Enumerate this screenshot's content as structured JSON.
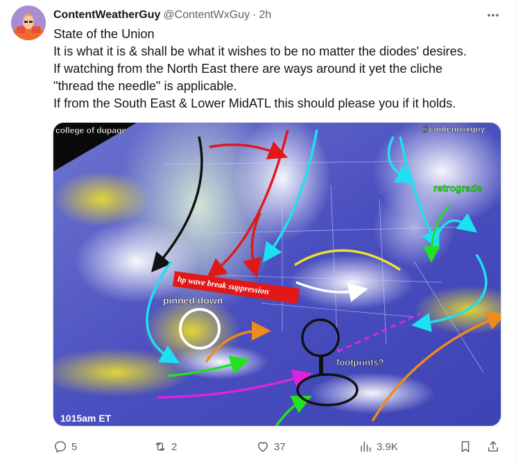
{
  "tweet": {
    "author_name": "ContentWeatherGuy",
    "handle": "@ContentWxGuy",
    "separator": "·",
    "time": "2h",
    "more_icon": "more-dots-icon",
    "lines": [
      "State of the Union",
      "It is what it is & shall be what it wishes to be no matter the diodes' desires.",
      "If watching from the North East there are ways around it yet the cliche",
      "\"thread the needle\" is applicable.",
      "If from the South East & Lower MidATL this should please you if it holds."
    ]
  },
  "image": {
    "watermark_left": "college of dupage",
    "watermark_right": "@contentwxguy",
    "label_retrograde": "retrograde",
    "label_hp": "hp wave break suppression",
    "label_pinned": "pinned down",
    "label_footprints": "footprints?",
    "label_time": "1015am ET"
  },
  "actions": {
    "reply": {
      "icon": "reply-icon",
      "count": "5"
    },
    "retweet": {
      "icon": "retweet-icon",
      "count": "2"
    },
    "like": {
      "icon": "heart-icon",
      "count": "37"
    },
    "views": {
      "icon": "views-icon",
      "count": "3.9K"
    },
    "bookmark": {
      "icon": "bookmark-icon"
    },
    "share": {
      "icon": "share-icon"
    }
  },
  "colors": {
    "text_primary": "#0f1419",
    "text_secondary": "#536471",
    "border": "#cfd9de"
  }
}
